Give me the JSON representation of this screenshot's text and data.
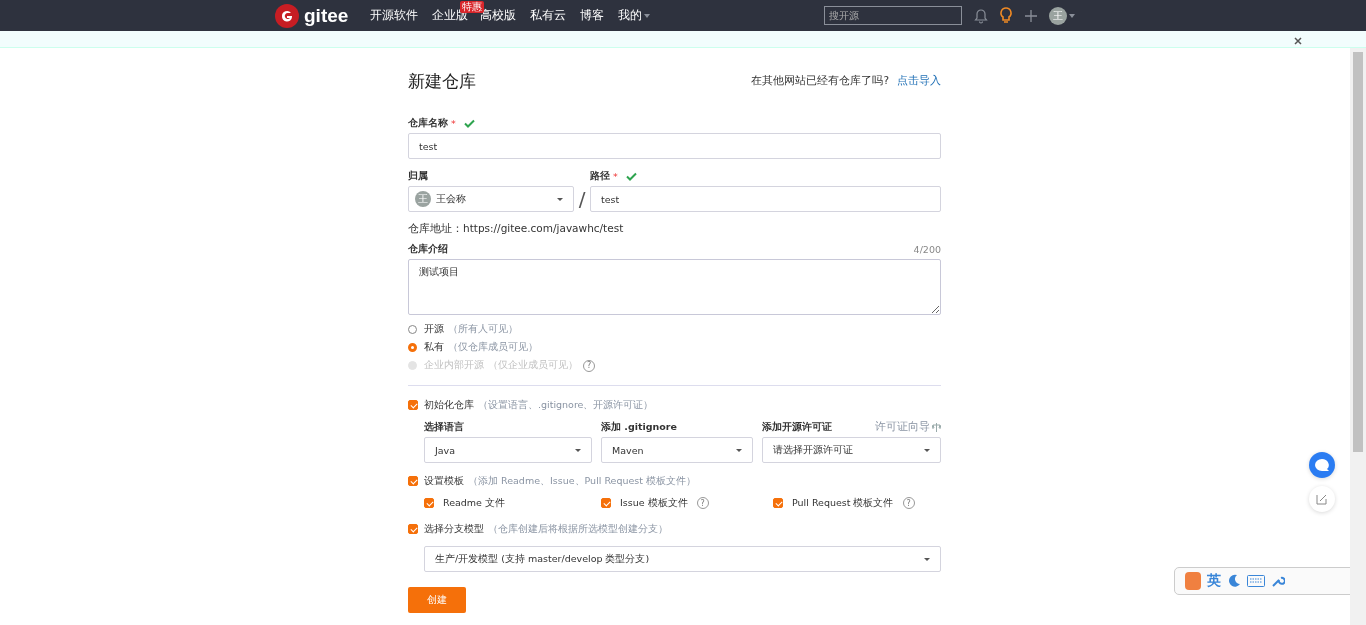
{
  "required_mark": "*",
  "separator": "/",
  "help_glyph": "?",
  "nav": {
    "logo": "gitee",
    "items": [
      {
        "label": "开源软件",
        "dropdown": false
      },
      {
        "label": "企业版",
        "badge": "特惠",
        "dropdown": false
      },
      {
        "label": "高校版",
        "dropdown": false
      },
      {
        "label": "私有云",
        "dropdown": false
      },
      {
        "label": "博客",
        "dropdown": false
      },
      {
        "label": "我的",
        "dropdown": true
      }
    ],
    "search": {
      "placeholder": "搜开源"
    },
    "avatar": "王"
  },
  "title": "新建仓库",
  "import_prompt": "在其他网站已经有仓库了吗?",
  "import_link": "点击导入",
  "name_field": {
    "label": "仓库名称",
    "value": "test",
    "valid": true
  },
  "owner": {
    "label": "归属",
    "avatar": "王",
    "value": "王会称"
  },
  "path_field": {
    "label": "路径",
    "value": "test",
    "valid": true
  },
  "repo_url": "仓库地址：https://gitee.com/javawhc/test",
  "description": {
    "label": "仓库介绍",
    "counter": "4/200",
    "value": "测试项目"
  },
  "visibility": [
    {
      "label": "开源",
      "hint": "（所有人可见）",
      "selected": false,
      "disabled": false,
      "help": false
    },
    {
      "label": "私有",
      "hint": "（仅仓库成员可见）",
      "selected": true,
      "disabled": false,
      "help": false
    },
    {
      "label": "企业内部开源",
      "hint": "（仅企业成员可见）",
      "selected": false,
      "disabled": true,
      "help": true
    }
  ],
  "init": {
    "label": "初始化仓库",
    "hint": "（设置语言、.gitignore、开源许可证）",
    "checked": true,
    "selects": [
      {
        "label": "选择语言",
        "value": "Java"
      },
      {
        "label": "添加 .gitignore",
        "value": "Maven"
      },
      {
        "label": "添加开源许可证",
        "value": "请选择开源许可证"
      }
    ],
    "license_guide": "许可证向导"
  },
  "templates": {
    "label": "设置模板",
    "hint": "（添加 Readme、Issue、Pull Request 模板文件）",
    "checked": true,
    "items": [
      {
        "label": "Readme 文件",
        "checked": true,
        "help": false
      },
      {
        "label": "Issue 模板文件",
        "checked": true,
        "help": true
      },
      {
        "label": "Pull Request 模板文件",
        "checked": true,
        "help": true
      }
    ]
  },
  "branch": {
    "label": "选择分支模型",
    "hint": "（仓库创建后将根据所选模型创建分支）",
    "checked": true,
    "value": "生产/开发模型 (支持 master/develop 类型分支)"
  },
  "submit": "创建",
  "ime": {
    "mode": "英"
  }
}
